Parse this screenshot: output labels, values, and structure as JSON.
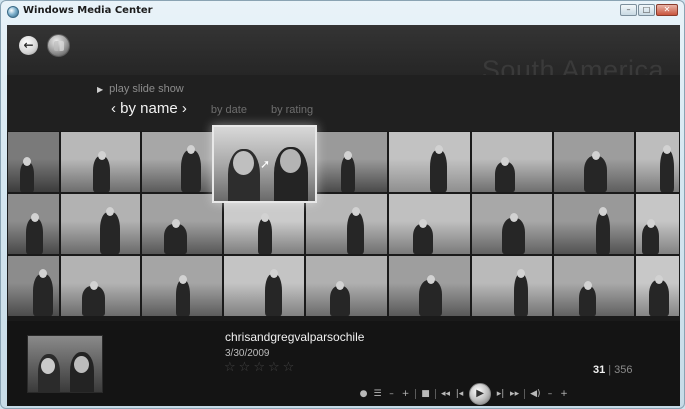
{
  "window": {
    "title": "Windows Media Center",
    "minimize": "–",
    "maximize": "□",
    "close": "✕"
  },
  "header": {
    "back_glyph": "←",
    "section_title": "South America"
  },
  "menu": {
    "slideshow_label": "play slide show",
    "sort_active": "‹ by name ›",
    "sort_options": [
      "by date",
      "by rating"
    ]
  },
  "grid": {
    "thumbnails": [
      {
        "c1": "#7a7a7a",
        "c2": "#3c3c3c"
      },
      {
        "c1": "#b8b8b8",
        "c2": "#6d6d6d"
      },
      {
        "c1": "#a7a7a7",
        "c2": "#5a5a5a"
      },
      {
        "c1": "#cfcfcf",
        "c2": "#8a8a8a"
      },
      {
        "c1": "#9a9a9a",
        "c2": "#4a4a4a"
      },
      {
        "c1": "#c2c2c2",
        "c2": "#8f8f8f"
      },
      {
        "c1": "#bcbcbc",
        "c2": "#6f6f6f"
      },
      {
        "c1": "#9d9d9d",
        "c2": "#5e5e5e"
      },
      {
        "c1": "#bdbdbd",
        "c2": "#7a7a7a"
      },
      {
        "c1": "#8d8d8d",
        "c2": "#494949"
      },
      {
        "c1": "#b2b2b2",
        "c2": "#6a6a6a"
      },
      {
        "c1": "#a2a2a2",
        "c2": "#575757"
      },
      {
        "c1": "#cbcbcb",
        "c2": "#7e7e7e"
      },
      {
        "c1": "#b7b7b7",
        "c2": "#707070"
      },
      {
        "c1": "#c0c0c0",
        "c2": "#7b7b7b"
      },
      {
        "c1": "#a8a8a8",
        "c2": "#636363"
      },
      {
        "c1": "#999999",
        "c2": "#525252"
      },
      {
        "c1": "#c6c6c6",
        "c2": "#828282"
      },
      {
        "c1": "#8c8c8c",
        "c2": "#4c4c4c"
      },
      {
        "c1": "#b3b3b3",
        "c2": "#6c6c6c"
      },
      {
        "c1": "#a5a5a5",
        "c2": "#5c5c5c"
      },
      {
        "c1": "#c4c4c4",
        "c2": "#818181"
      },
      {
        "c1": "#b0b0b0",
        "c2": "#6b6b6b"
      },
      {
        "c1": "#9e9e9e",
        "c2": "#595959"
      },
      {
        "c1": "#bababa",
        "c2": "#747474"
      },
      {
        "c1": "#a9a9a9",
        "c2": "#616161"
      },
      {
        "c1": "#c8c8c8",
        "c2": "#858585"
      }
    ]
  },
  "details": {
    "file_name": "chrisandgregvalparsochile",
    "date": "3/30/2009",
    "stars": [
      "☆",
      "☆",
      "☆",
      "☆",
      "☆"
    ],
    "current_index": "31",
    "separator": "|",
    "total_count": "356"
  },
  "transport": {
    "record": "●",
    "guide": "☰",
    "minus_left": "–",
    "plus_left": "+",
    "stop": "■",
    "rewind": "◂◂",
    "prev": "|◂",
    "play": "▶",
    "next": "▸|",
    "fast_forward": "▸▸",
    "mute": "◀)",
    "vol_down": "–",
    "vol_up": "+"
  }
}
